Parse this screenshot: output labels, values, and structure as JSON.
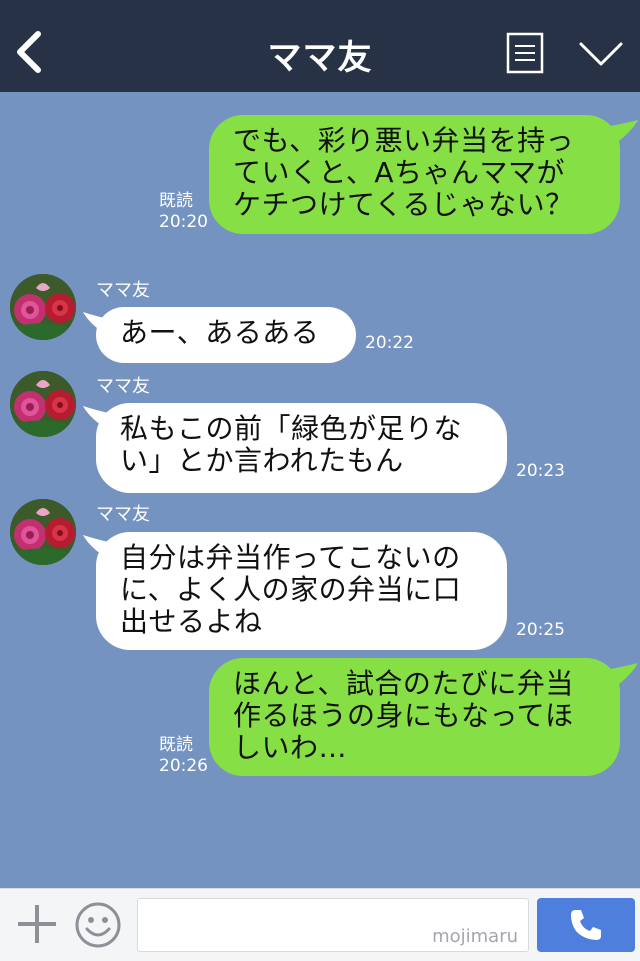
{
  "header": {
    "title": "ママ友",
    "icons": {
      "back": "chevron-left-icon",
      "memo": "memo-icon",
      "menu": "chevron-down-icon"
    }
  },
  "colors": {
    "background": "#7493c0",
    "header": "#273246",
    "outgoing_bubble": "#86e045",
    "incoming_bubble": "#ffffff",
    "call_button": "#4f7fdd"
  },
  "messages": [
    {
      "direction": "outgoing",
      "lines": [
        "でも、彩り悪い弁当を持っ",
        "ていくと、Aちゃんママが",
        "ケチつけてくるじゃない？"
      ],
      "read_label": "既読",
      "time": "20:20"
    },
    {
      "direction": "incoming",
      "sender": "ママ友",
      "lines": [
        "あー、あるある"
      ],
      "time": "20:22"
    },
    {
      "direction": "incoming",
      "sender": "ママ友",
      "lines": [
        "私もこの前「緑色が足りな",
        "い」とか言われたもん"
      ],
      "time": "20:23"
    },
    {
      "direction": "incoming",
      "sender": "ママ友",
      "lines": [
        "自分は弁当作ってこないの",
        "に、よく人の家の弁当に口",
        "出せるよね"
      ],
      "time": "20:25"
    },
    {
      "direction": "outgoing",
      "lines": [
        "ほんと、試合のたびに弁当",
        "作るほうの身にもなってほ",
        "しいわ…"
      ],
      "read_label": "既読",
      "time": "20:26"
    }
  ],
  "footer": {
    "input_value": "",
    "watermark": "mojimaru",
    "icons": {
      "add": "plus-icon",
      "sticker": "emoji-icon",
      "call": "phone-icon"
    }
  }
}
